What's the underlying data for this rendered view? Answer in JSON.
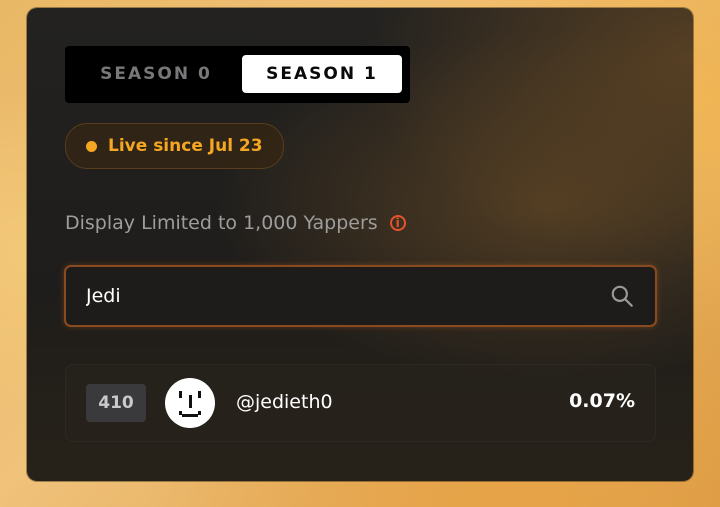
{
  "tabs": [
    {
      "label": "SEASON 0",
      "active": false
    },
    {
      "label": "SEASON 1",
      "active": true
    }
  ],
  "live_badge": {
    "text": "Live since Jul 23",
    "color": "#f5a623"
  },
  "notice": {
    "text": "Display Limited to 1,000 Yappers",
    "icon": "info-icon"
  },
  "search": {
    "value": "Jedi",
    "icon": "search-icon"
  },
  "results": [
    {
      "rank": "410",
      "username": "@jedieth0",
      "share": "0.07%"
    }
  ],
  "colors": {
    "accent": "#f5a623",
    "info": "#e5532d",
    "search_border": "#8a4a1f"
  }
}
